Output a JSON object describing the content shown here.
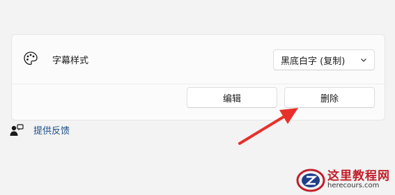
{
  "setting": {
    "label": "字幕样式",
    "dropdown_value": "黑底白字 (复制)",
    "edit_label": "编辑",
    "delete_label": "删除"
  },
  "feedback": {
    "label": "提供反馈"
  },
  "icons": {
    "setting_icon": "palette-icon",
    "dropdown_icon": "chevron-down-icon",
    "feedback_icon": "feedback-person-icon"
  },
  "annotation": {
    "color": "#e8302a"
  },
  "watermark": {
    "title": "这里教程网",
    "url": "herecours.com"
  }
}
